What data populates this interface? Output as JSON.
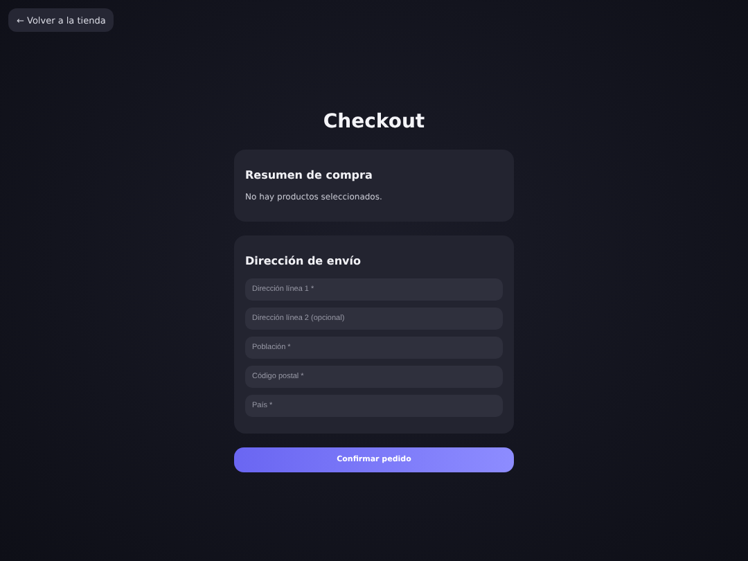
{
  "back_link": {
    "label": "← Volver a la tienda"
  },
  "title": "Checkout",
  "summary": {
    "heading": "Resumen de compra",
    "text": "No hay productos seleccionados."
  },
  "shipping": {
    "heading": "Dirección de envío",
    "fields": [
      {
        "placeholder": "Dirección línea 1 *"
      },
      {
        "placeholder": "Dirección línea 2 (opcional)"
      },
      {
        "placeholder": "Población *"
      },
      {
        "placeholder": "Código postal *"
      },
      {
        "placeholder": "País *"
      }
    ]
  },
  "confirm_button": {
    "label": "Confirmar pedido"
  }
}
